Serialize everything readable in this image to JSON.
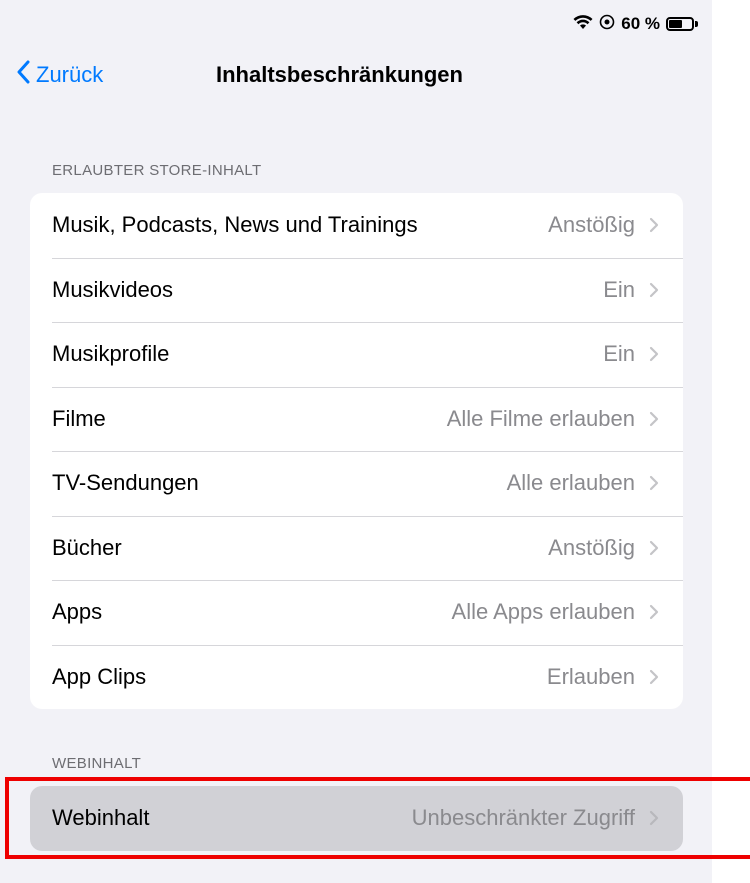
{
  "status_bar": {
    "wifi_icon": "wifi-icon",
    "location_icon": "location-lock-icon",
    "battery_text": "60 %",
    "battery_level_percent": 60
  },
  "nav": {
    "back_label": "Zurück",
    "title": "Inhaltsbeschränkungen"
  },
  "store_section": {
    "header": "ERLAUBTER STORE-INHALT",
    "rows": [
      {
        "label": "Musik, Podcasts, News und Trainings",
        "value": "Anstößig"
      },
      {
        "label": "Musikvideos",
        "value": "Ein"
      },
      {
        "label": "Musikprofile",
        "value": "Ein"
      },
      {
        "label": "Filme",
        "value": "Alle Filme erlauben"
      },
      {
        "label": "TV-Sendungen",
        "value": "Alle erlauben"
      },
      {
        "label": "Bücher",
        "value": "Anstößig"
      },
      {
        "label": "Apps",
        "value": "Alle Apps erlauben"
      },
      {
        "label": "App Clips",
        "value": "Erlauben"
      }
    ]
  },
  "web_section": {
    "header": "WEBINHALT",
    "row": {
      "label": "Webinhalt",
      "value": "Unbeschränkter Zugriff"
    }
  },
  "colors": {
    "accent": "#007aff",
    "background": "#f2f2f7",
    "highlight_box": "#ee0000",
    "selected_row": "#d1d1d6"
  }
}
